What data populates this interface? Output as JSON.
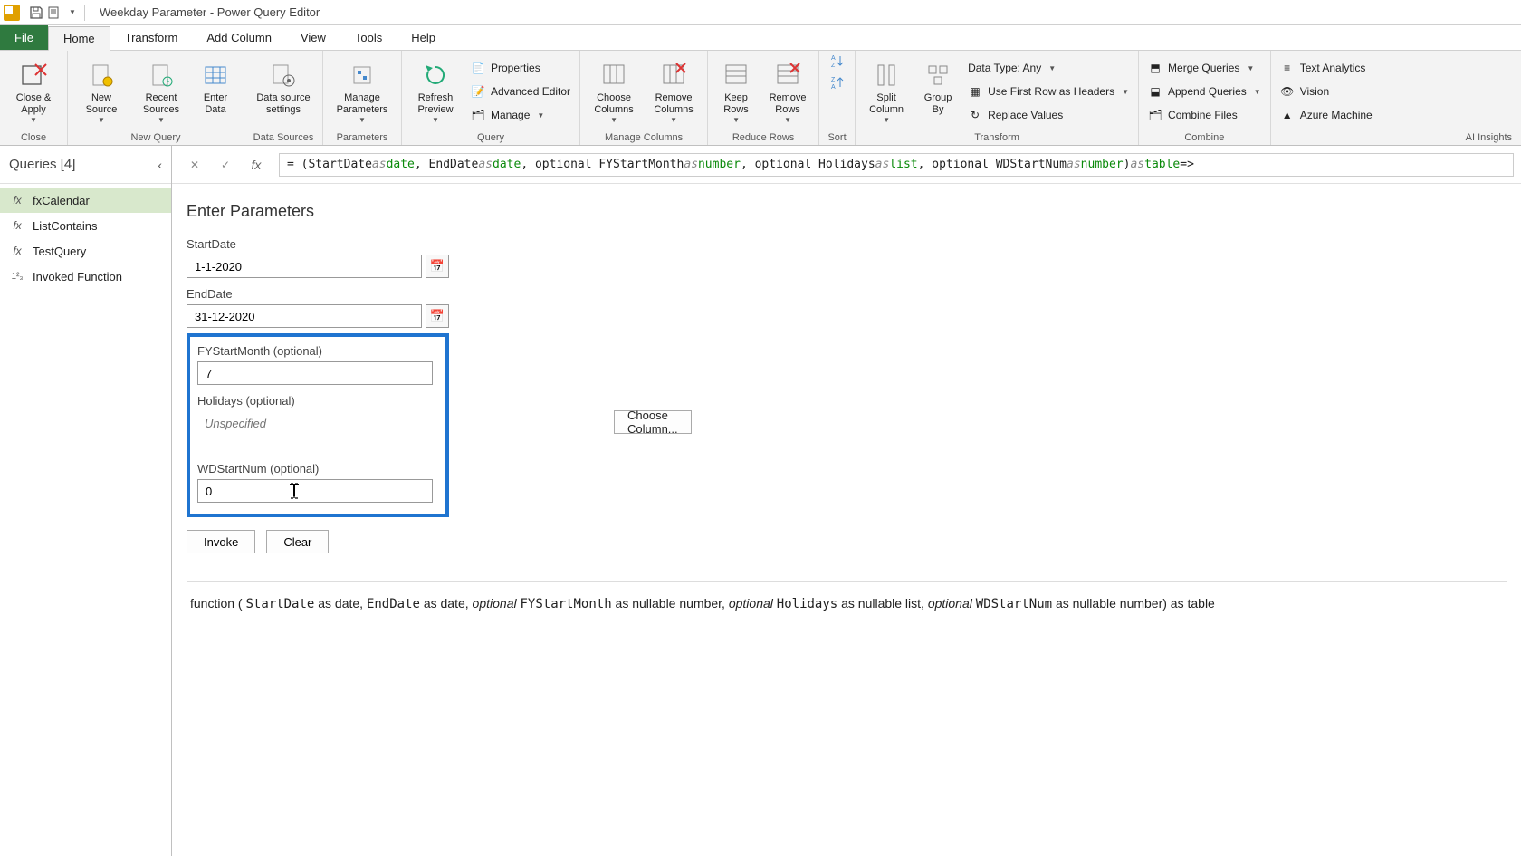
{
  "window": {
    "title": "Weekday Parameter - Power Query Editor"
  },
  "menu": {
    "file": "File",
    "tabs": [
      "Home",
      "Transform",
      "Add Column",
      "View",
      "Tools",
      "Help"
    ]
  },
  "ribbon": {
    "close": {
      "close_apply": "Close &\nApply",
      "group": "Close"
    },
    "newquery": {
      "new_source": "New\nSource",
      "recent_sources": "Recent\nSources",
      "enter_data": "Enter\nData",
      "group": "New Query"
    },
    "datasources": {
      "data_source_settings": "Data source\nsettings",
      "group": "Data Sources"
    },
    "parameters": {
      "manage_parameters": "Manage\nParameters",
      "group": "Parameters"
    },
    "query": {
      "refresh_preview": "Refresh\nPreview",
      "properties": "Properties",
      "advanced_editor": "Advanced Editor",
      "manage": "Manage",
      "group": "Query"
    },
    "mcols": {
      "choose_columns": "Choose\nColumns",
      "remove_columns": "Remove\nColumns",
      "group": "Manage Columns"
    },
    "rrows": {
      "keep_rows": "Keep\nRows",
      "remove_rows": "Remove\nRows",
      "group": "Reduce Rows"
    },
    "sort": {
      "group": "Sort"
    },
    "transform": {
      "split_column": "Split\nColumn",
      "group_by": "Group\nBy",
      "data_type": "Data Type: Any",
      "first_row": "Use First Row as Headers",
      "replace_values": "Replace Values",
      "group": "Transform"
    },
    "combine": {
      "merge": "Merge Queries",
      "append": "Append Queries",
      "combine_files": "Combine Files",
      "group": "Combine"
    },
    "ai": {
      "text_analytics": "Text Analytics",
      "vision": "Vision",
      "azure_ml": "Azure Machine",
      "group": "AI Insights"
    }
  },
  "queries": {
    "header": "Queries [4]",
    "items": [
      {
        "icon": "fx",
        "label": "fxCalendar",
        "selected": true
      },
      {
        "icon": "fx",
        "label": "ListContains",
        "selected": false
      },
      {
        "icon": "fx",
        "label": "TestQuery",
        "selected": false
      },
      {
        "icon": "123",
        "label": "Invoked Function",
        "selected": false
      }
    ]
  },
  "formula": {
    "prefix": " = (StartDate ",
    "as1": "as ",
    "t1": "date",
    "c1": ", EndDate ",
    "as2": "as ",
    "t2": "date",
    "c2": ", optional FYStartMonth ",
    "as3": "as ",
    "t3": "number",
    "c3": ", optional Holidays ",
    "as4": "as ",
    "t4": "list",
    "c4": ", optional WDStartNum ",
    "as5": "as ",
    "t5": "number",
    "c5": ") ",
    "as6": "as ",
    "t6": "table",
    "suffix": " =>"
  },
  "params": {
    "title": "Enter Parameters",
    "startdate": {
      "label": "StartDate",
      "value": "1-1-2020"
    },
    "enddate": {
      "label": "EndDate",
      "value": "31-12-2020"
    },
    "fystart": {
      "label": "FYStartMonth (optional)",
      "value": "7"
    },
    "holidays": {
      "label": "Holidays (optional)",
      "placeholder": "Unspecified"
    },
    "choose_col": "Choose Column...",
    "wdstart": {
      "label": "WDStartNum (optional)",
      "value": "0"
    },
    "invoke": "Invoke",
    "clear": "Clear"
  },
  "signature": {
    "p1": "function (",
    "s1": "StartDate",
    "p2": " as date, ",
    "s2": "EndDate",
    "p3": " as date, ",
    "o1": "optional ",
    "s3": "FYStartMonth",
    "p4": " as nullable number, ",
    "o2": "optional ",
    "s4": "Holidays",
    "p5": " as nullable list, ",
    "o3": "optional ",
    "s5": "WDStartNum",
    "p6": " as nullable number) as table"
  }
}
